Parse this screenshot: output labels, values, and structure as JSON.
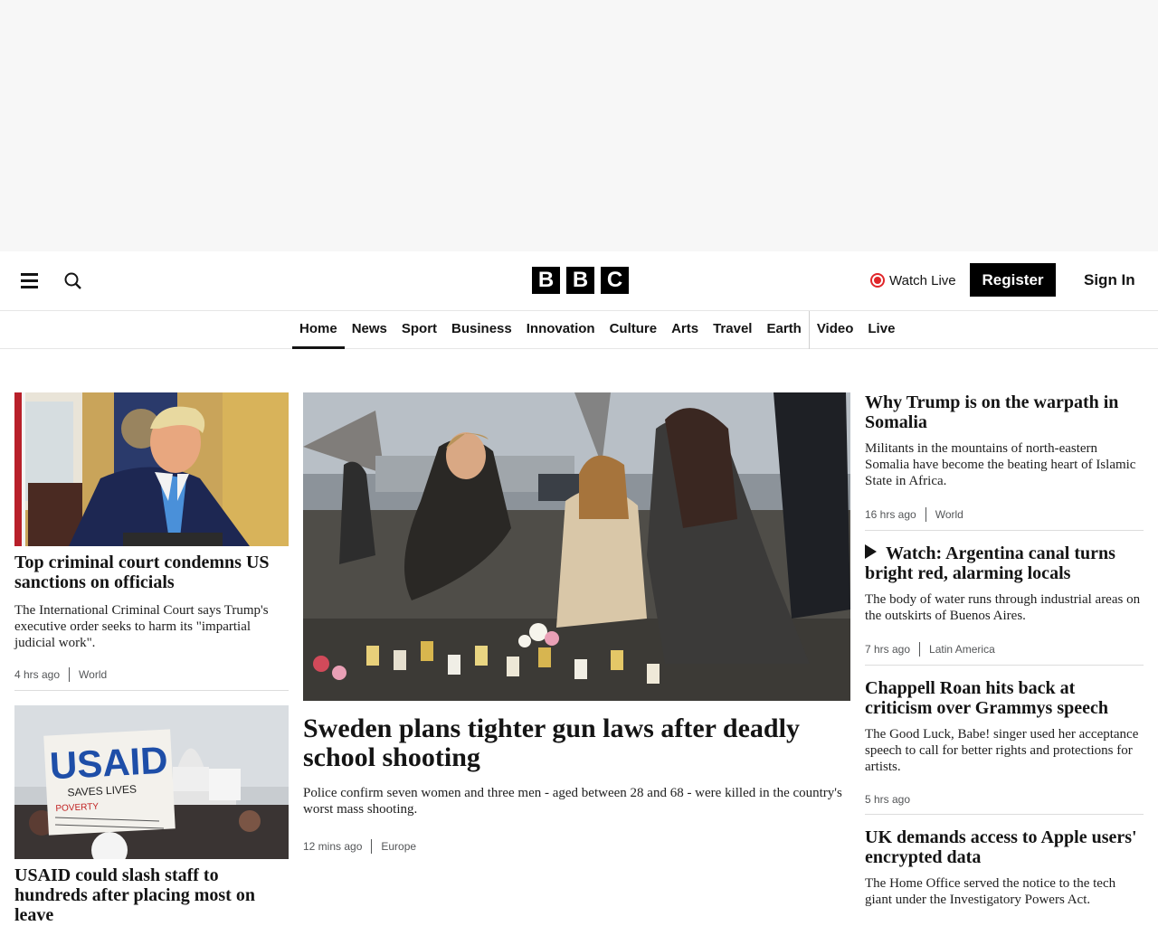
{
  "header": {
    "logo_letters": [
      "B",
      "B",
      "C"
    ],
    "watch_live_label": "Watch Live",
    "register_label": "Register",
    "signin_label": "Sign In"
  },
  "nav": {
    "items": [
      "Home",
      "News",
      "Sport",
      "Business",
      "Innovation",
      "Culture",
      "Arts",
      "Travel",
      "Earth",
      "Video",
      "Live"
    ],
    "active": "Home"
  },
  "left": {
    "stories": [
      {
        "title": "Top criminal court condemns US sanctions on officials",
        "description": "The International Criminal Court says Trump's executive order seeks to harm its \"impartial judicial work\".",
        "time": "4 hrs ago",
        "section": "World"
      },
      {
        "title": "USAID could slash staff to hundreds after placing most on leave",
        "sign_text_1": "USAID",
        "sign_text_2": "SAVES LIVES",
        "sign_text_3": "POVERTY"
      }
    ]
  },
  "center": {
    "title": "Sweden plans tighter gun laws after deadly school shooting",
    "description": "Police confirm seven women and three men - aged between 28 and 68 - were killed in the country's worst mass shooting.",
    "time": "12 mins ago",
    "section": "Europe"
  },
  "right": {
    "stories": [
      {
        "title": "Why Trump is on the warpath in Somalia",
        "description": "Militants in the mountains of north-eastern Somalia have become the beating heart of Islamic State in Africa.",
        "time": "16 hrs ago",
        "section": "World"
      },
      {
        "title": "Watch: Argentina canal turns bright red, alarming locals",
        "description": "The body of water runs through industrial areas on the outskirts of Buenos Aires.",
        "time": "7 hrs ago",
        "section": "Latin America"
      },
      {
        "title": "Chappell Roan hits back at criticism over Grammys speech",
        "description": "The Good Luck, Babe! singer used her acceptance speech to call for better rights and protections for artists.",
        "time": "5 hrs ago"
      },
      {
        "title": "UK demands access to Apple users' encrypted data",
        "description": "The Home Office served the notice to the tech giant under the Investigatory Powers Act."
      }
    ]
  },
  "colors": {
    "live_red": "#e0262a",
    "text": "#141414",
    "meta": "#545658",
    "ad_bg": "#f7f7f7"
  }
}
